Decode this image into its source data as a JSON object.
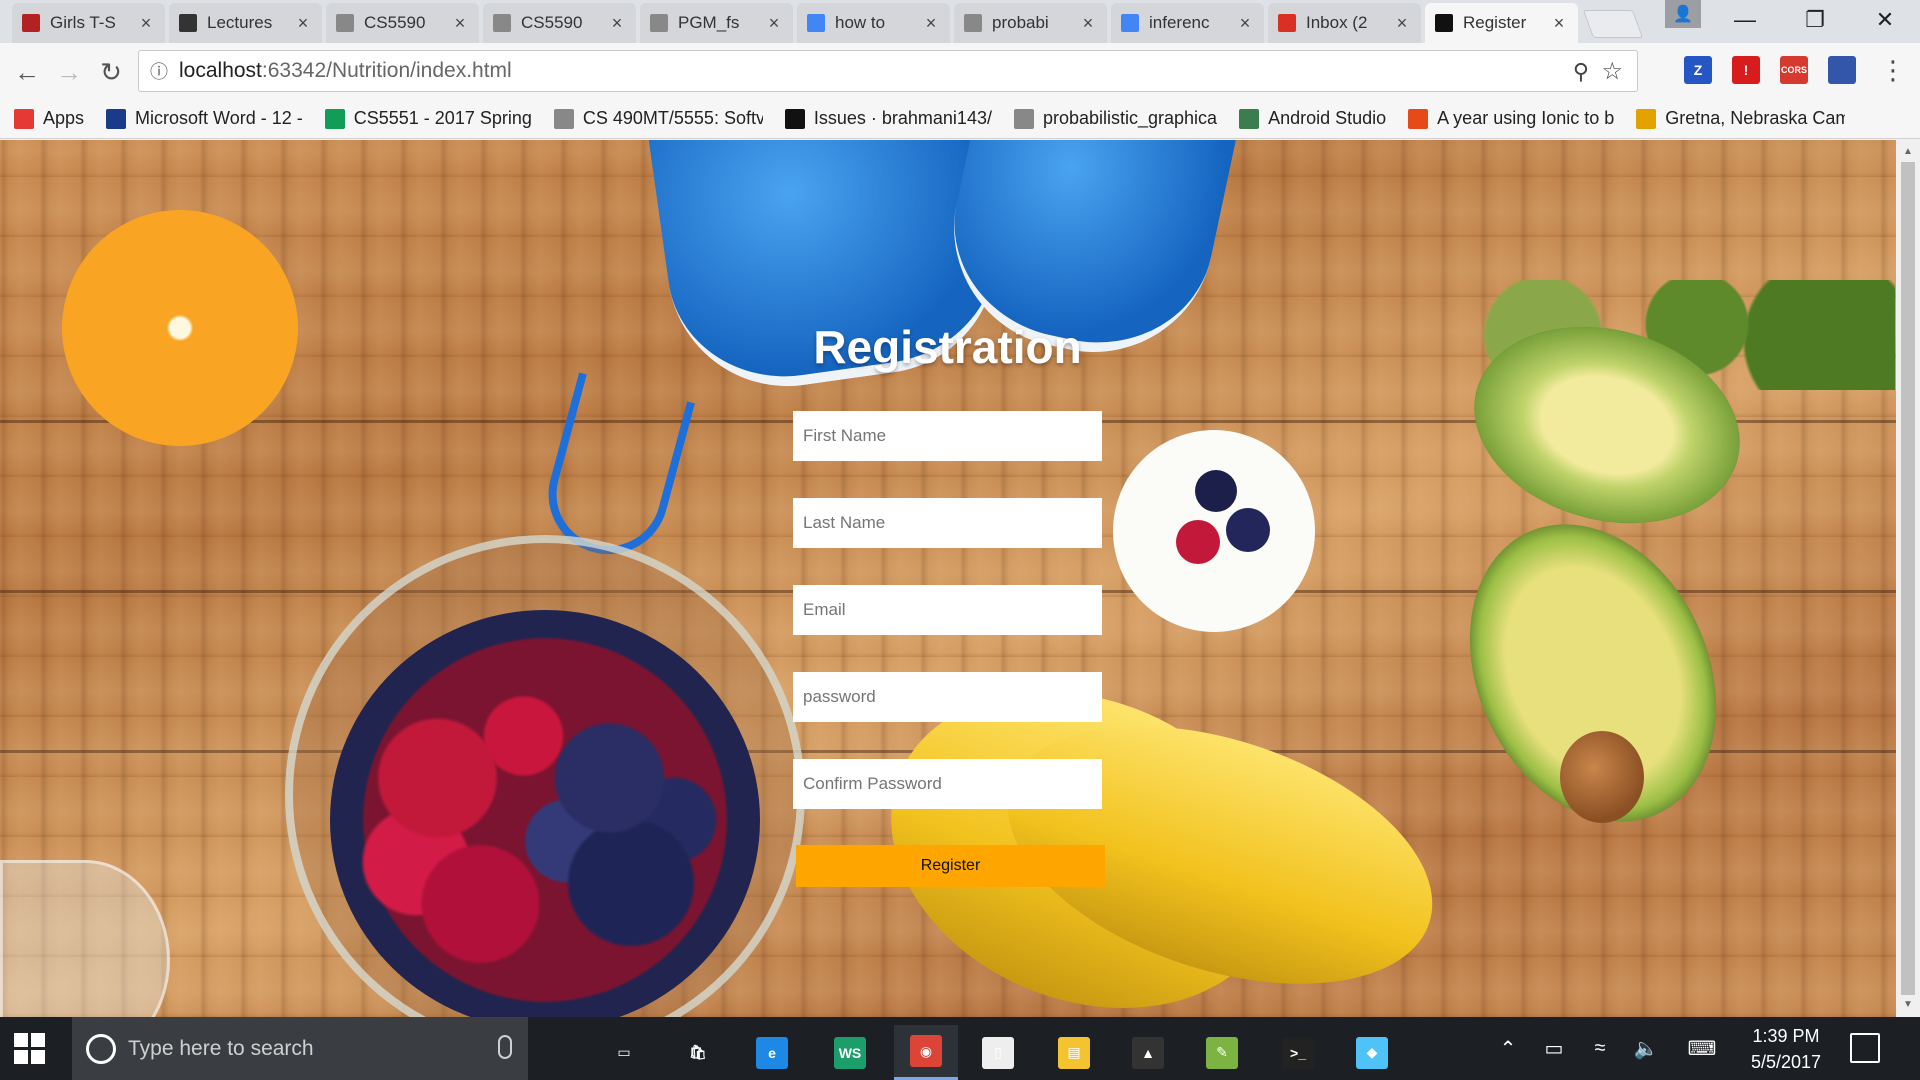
{
  "browser": {
    "tabs": [
      {
        "title": "Girls T-S",
        "icon": "hollister-icon",
        "color": "#b22222"
      },
      {
        "title": "Lectures",
        "icon": "blackboard-icon",
        "color": "#333333"
      },
      {
        "title": "CS5590",
        "icon": "document-icon",
        "color": "#888888"
      },
      {
        "title": "CS5590",
        "icon": "document-icon",
        "color": "#888888"
      },
      {
        "title": "PGM_fs",
        "icon": "document-icon",
        "color": "#888888"
      },
      {
        "title": "how to",
        "icon": "google-icon",
        "color": "#4285f4"
      },
      {
        "title": "probabi",
        "icon": "document-icon",
        "color": "#888888"
      },
      {
        "title": "inferenc",
        "icon": "google-icon",
        "color": "#4285f4"
      },
      {
        "title": "Inbox (2",
        "icon": "gmail-icon",
        "color": "#d93025"
      },
      {
        "title": "Register",
        "icon": "webstorm-icon",
        "color": "#111111",
        "active": true
      }
    ],
    "tab_close_glyph": "×",
    "window_controls": {
      "minimize": "—",
      "restore": "❐",
      "close": "✕"
    },
    "url_host": "localhost",
    "url_path": ":63342/Nutrition/index.html",
    "extensions": [
      {
        "name": "z-extension-icon",
        "label": "Z",
        "color": "#2456c4"
      },
      {
        "name": "adblock-icon",
        "label": "!",
        "color": "#d81b1b"
      },
      {
        "name": "cors-extension-icon",
        "label": "CORS",
        "color": "#d63a2f"
      },
      {
        "name": "flag-extension-icon",
        "label": "",
        "color": "#3355aa"
      }
    ],
    "bookmarks": [
      {
        "label": "Apps",
        "icon": "apps-grid-icon",
        "color": "#e53935"
      },
      {
        "label": "Microsoft Word - 12 -",
        "icon": "umkc-icon",
        "color": "#1a3a8a"
      },
      {
        "label": "CS5551 - 2017 Spring",
        "icon": "sheets-icon",
        "color": "#0f9d58"
      },
      {
        "label": "CS 490MT/5555: Softv",
        "icon": "document-icon",
        "color": "#888888"
      },
      {
        "label": "Issues · brahmani143/",
        "icon": "github-icon",
        "color": "#111111"
      },
      {
        "label": "probabilistic_graphica",
        "icon": "document-icon",
        "color": "#888888"
      },
      {
        "label": "Android Studio",
        "icon": "android-studio-icon",
        "color": "#3b7d4f"
      },
      {
        "label": "A year using Ionic to b",
        "icon": "ionic-icon",
        "color": "#e64a19"
      },
      {
        "label": "Gretna, Nebraska Cam",
        "icon": "camping-icon",
        "color": "#e3a100"
      }
    ]
  },
  "page": {
    "title": "Registration",
    "fields": [
      {
        "name": "first-name-input",
        "placeholder": "First Name",
        "value": ""
      },
      {
        "name": "last-name-input",
        "placeholder": "Last Name",
        "value": ""
      },
      {
        "name": "email-input",
        "placeholder": "Email",
        "value": ""
      },
      {
        "name": "password-input",
        "placeholder": "password",
        "value": ""
      },
      {
        "name": "confirm-password-input",
        "placeholder": "Confirm Password",
        "value": ""
      }
    ],
    "submit_label": "Register",
    "accent_color": "#ffa500"
  },
  "taskbar": {
    "search_placeholder": "Type here to search",
    "apps": [
      {
        "name": "task-view-icon",
        "glyph": "▭",
        "color": "#1c1f24"
      },
      {
        "name": "store-icon",
        "glyph": "🛍",
        "color": "#1c1f24"
      },
      {
        "name": "edge-icon",
        "glyph": "e",
        "color": "#1e88e5"
      },
      {
        "name": "webstorm-taskbar-icon",
        "glyph": "WS",
        "color": "#1b9e6a"
      },
      {
        "name": "chrome-taskbar-icon",
        "glyph": "◉",
        "color": "#db4437",
        "active": true
      },
      {
        "name": "notepad-icon",
        "glyph": "▯",
        "color": "#eeeeee"
      },
      {
        "name": "file-explorer-icon",
        "glyph": "▤",
        "color": "#f4c430"
      },
      {
        "name": "photos-icon",
        "glyph": "▲",
        "color": "#333333"
      },
      {
        "name": "image-editor-icon",
        "glyph": "✎",
        "color": "#7cb342"
      },
      {
        "name": "cmd-icon",
        "glyph": ">_",
        "color": "#222222"
      },
      {
        "name": "app-icon",
        "glyph": "◆",
        "color": "#4fc3f7"
      }
    ],
    "time": "1:39 PM",
    "date": "5/5/2017"
  }
}
